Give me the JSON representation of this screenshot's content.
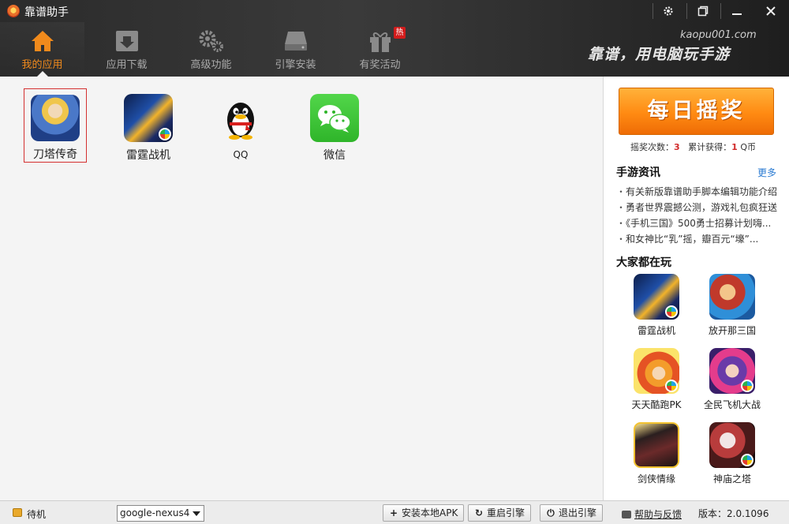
{
  "window": {
    "title": "靠谱助手",
    "controls": [
      "gear-icon",
      "restore-icon",
      "minimize-icon",
      "close-icon"
    ]
  },
  "nav": {
    "items": [
      {
        "label": "我的应用",
        "icon": "home-icon",
        "active": true
      },
      {
        "label": "应用下载",
        "icon": "download-icon",
        "active": false
      },
      {
        "label": "高级功能",
        "icon": "gears-icon",
        "active": false
      },
      {
        "label": "引擎安装",
        "icon": "drive-icon",
        "active": false
      },
      {
        "label": "有奖活动",
        "icon": "gift-icon",
        "active": false,
        "badge": "热"
      }
    ]
  },
  "header": {
    "url": "kaopu001.com",
    "slogan": "靠谱，用电脑玩手游"
  },
  "my_apps": [
    {
      "name": "刀塔传奇",
      "selected": true
    },
    {
      "name": "雷霆战机",
      "selected": false
    },
    {
      "name": "QQ",
      "selected": false
    },
    {
      "name": "微信",
      "selected": false
    }
  ],
  "sidebar": {
    "lottery_button": "每日摇奖",
    "lottery_count_label": "摇奖次数：",
    "lottery_count": "3",
    "earned_label": "累计获得：",
    "earned_value": "1",
    "earned_unit": "Q币",
    "news_title": "手游资讯",
    "more_label": "更多",
    "news": [
      "有关新版靠谱助手脚本编辑功能介绍",
      "勇者世界震撼公测，游戏礼包疯狂送",
      "《手机三国》500勇士招募计划嗨...",
      "和女神比“乳”摇，瓣百元“壕”..."
    ],
    "popular_title": "大家都在玩",
    "popular": [
      {
        "name": "雷霆战机"
      },
      {
        "name": "放开那三国"
      },
      {
        "name": "天天酷跑PK"
      },
      {
        "name": "全民飞机大战"
      },
      {
        "name": "剑侠情缘"
      },
      {
        "name": "神庙之塔"
      }
    ]
  },
  "statusbar": {
    "status": "待机",
    "device": "google-nexus4",
    "install_apk": "安装本地APK",
    "restart_engine": "重启引擎",
    "exit_engine": "退出引擎",
    "help": "帮助与反馈",
    "version_label": "版本：",
    "version": "2.0.1096"
  },
  "colors": {
    "accent_orange": "#f08a1c",
    "header_dark": "#2b2b2b",
    "selected_border": "#d43030",
    "link_blue": "#2a7ad2"
  }
}
